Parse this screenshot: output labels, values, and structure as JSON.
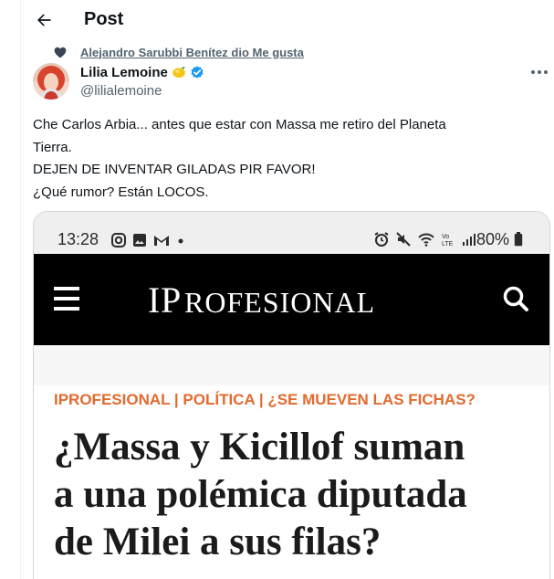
{
  "header": {
    "title": "Post"
  },
  "social_context": {
    "text": "Alejandro Sarubbi Benítez dio Me gusta"
  },
  "author": {
    "name": "Lilia Lemoine",
    "handle": "@lilialemoine",
    "badge": "verified-icon",
    "emoji": "lemon"
  },
  "tweet": {
    "lines": [
      "Che Carlos Arbia... antes que estar con Massa me retiro del Planeta",
      "Tierra.",
      "DEJEN DE INVENTAR GILADAS PIR FAVOR!",
      "¿Qué rumor? Están LOCOS."
    ]
  },
  "media": {
    "status_bar": {
      "time": "13:28",
      "battery": "80%",
      "network": "Vo LTE"
    },
    "site": {
      "logo": "iProfesional"
    },
    "article": {
      "kicker": "IPROFESIONAL | POLÍTICA | ¿SE MUEVEN LAS FICHAS?",
      "headline_lines": [
        "¿Massa y Kicillof suman",
        "a una polémica diputada",
        "de Milei a sus filas?"
      ]
    }
  },
  "colors": {
    "text_primary": "#0f1419",
    "text_secondary": "#536471",
    "verified": "#1d9bf0",
    "kicker": "#e36a2e",
    "navbar": "#000000"
  }
}
